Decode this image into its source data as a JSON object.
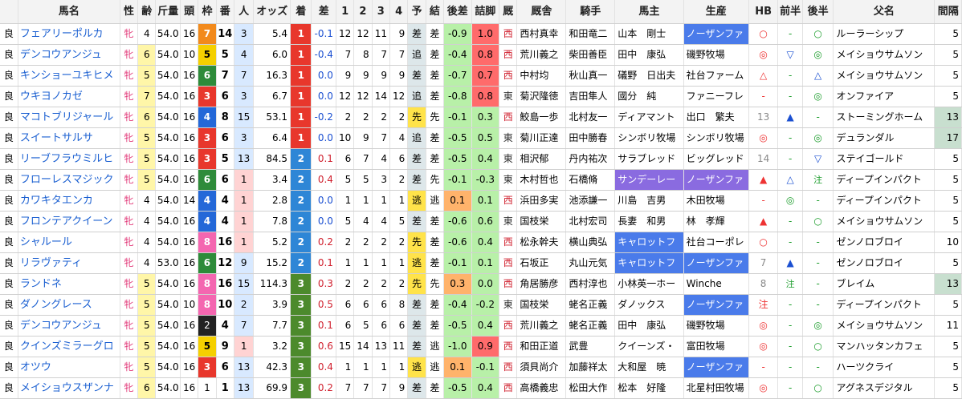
{
  "headers": [
    "",
    "馬名",
    "性",
    "齢",
    "斤量",
    "頭",
    "枠",
    "番",
    "人",
    "オッズ",
    "着",
    "差",
    "1",
    "2",
    "3",
    "4",
    "予",
    "結",
    "後差",
    "詰脚",
    "厩",
    "厩舎",
    "騎手",
    "馬主",
    "生産",
    "HB",
    "前半",
    "後半",
    "父名",
    "間隔"
  ],
  "rows": [
    [
      "良",
      "フェアリーポルカ",
      "牝",
      "4",
      "54.0",
      "16",
      "7",
      "14",
      "3",
      "5.4",
      "1",
      "-0.1",
      "12",
      "12",
      "11",
      "9",
      "差",
      "差",
      "-0.9",
      "1.0",
      "西",
      "西村真幸",
      "和田竜二",
      "山本　剛士",
      "ノーザンファ",
      "○",
      "-",
      "○",
      "ルーラーシップ",
      "5"
    ],
    [
      "良",
      "デンコウアンジュ",
      "牝",
      "6",
      "54.0",
      "10",
      "5",
      "5",
      "4",
      "6.0",
      "1",
      "-0.4",
      "7",
      "8",
      "7",
      "7",
      "追",
      "差",
      "-0.4",
      "0.8",
      "西",
      "荒川義之",
      "柴田善臣",
      "田中　康弘",
      "磯野牧場",
      "◎",
      "▽",
      "◎",
      "メイショウサムソン",
      "5"
    ],
    [
      "良",
      "キンショーユキヒメ",
      "牝",
      "5",
      "54.0",
      "16",
      "6",
      "7",
      "7",
      "16.3",
      "1",
      "0.0",
      "9",
      "9",
      "9",
      "9",
      "差",
      "差",
      "-0.7",
      "0.7",
      "西",
      "中村均",
      "秋山真一",
      "礒野　日出夫",
      "社台ファーム",
      "△",
      "-",
      "△",
      "メイショウサムソン",
      "5"
    ],
    [
      "良",
      "ウキヨノカゼ",
      "牝",
      "7",
      "54.0",
      "16",
      "3",
      "6",
      "3",
      "6.7",
      "1",
      "0.0",
      "12",
      "12",
      "14",
      "12",
      "追",
      "差",
      "-0.8",
      "0.8",
      "東",
      "菊沢隆徳",
      "吉田隼人",
      "國分　純",
      "ファニーフレ",
      "-",
      "-",
      "◎",
      "オンファイア",
      "5"
    ],
    [
      "良",
      "マコトブリジャール",
      "牝",
      "6",
      "54.0",
      "16",
      "4",
      "8",
      "15",
      "53.1",
      "1",
      "-0.2",
      "2",
      "2",
      "2",
      "2",
      "先",
      "先",
      "-0.1",
      "0.3",
      "西",
      "鮫島一歩",
      "北村友一",
      "ディアマント",
      "出口　繁夫",
      "13",
      "▲",
      "-",
      "ストーミングホーム",
      "13"
    ],
    [
      "良",
      "スイートサルサ",
      "牝",
      "5",
      "54.0",
      "16",
      "3",
      "6",
      "3",
      "6.4",
      "1",
      "0.0",
      "10",
      "9",
      "7",
      "4",
      "追",
      "差",
      "-0.5",
      "0.5",
      "東",
      "菊川正達",
      "田中勝春",
      "シンボリ牧場",
      "シンボリ牧場",
      "◎",
      "-",
      "◎",
      "デュランダル",
      "17"
    ],
    [
      "良",
      "リーブフラウミルヒ",
      "牝",
      "5",
      "54.0",
      "16",
      "3",
      "5",
      "13",
      "84.5",
      "2",
      "0.1",
      "6",
      "7",
      "4",
      "6",
      "差",
      "差",
      "-0.5",
      "0.4",
      "東",
      "相沢郁",
      "丹内祐次",
      "サラブレッド",
      "ビッグレッド",
      "14",
      "-",
      "▽",
      "ステイゴールド",
      "5"
    ],
    [
      "良",
      "フローレスマジック",
      "牝",
      "5",
      "54.0",
      "16",
      "6",
      "6",
      "1",
      "3.4",
      "2",
      "0.4",
      "5",
      "5",
      "3",
      "2",
      "差",
      "先",
      "-0.1",
      "-0.3",
      "東",
      "木村哲也",
      "石橋脩",
      "サンデーレー",
      "ノーザンファ",
      "▲",
      "△",
      "注",
      "ディープインパクト",
      "5"
    ],
    [
      "良",
      "カワキタエンカ",
      "牝",
      "4",
      "54.0",
      "14",
      "4",
      "4",
      "1",
      "2.8",
      "2",
      "0.0",
      "1",
      "1",
      "1",
      "1",
      "逃",
      "逃",
      "0.1",
      "0.1",
      "西",
      "浜田多実",
      "池添謙一",
      "川島　吉男",
      "木田牧場",
      "-",
      "◎",
      "-",
      "ディープインパクト",
      "5"
    ],
    [
      "良",
      "フロンテアクイーン",
      "牝",
      "4",
      "54.0",
      "16",
      "4",
      "4",
      "1",
      "7.8",
      "2",
      "0.0",
      "5",
      "4",
      "4",
      "5",
      "差",
      "差",
      "-0.6",
      "0.6",
      "東",
      "国枝栄",
      "北村宏司",
      "長妻　和男",
      "林　孝輝",
      "▲",
      "-",
      "○",
      "メイショウサムソン",
      "5"
    ],
    [
      "良",
      "シャルール",
      "牝",
      "4",
      "54.0",
      "16",
      "8",
      "16",
      "1",
      "5.2",
      "2",
      "0.2",
      "2",
      "2",
      "2",
      "2",
      "先",
      "差",
      "-0.6",
      "0.4",
      "西",
      "松永幹夫",
      "横山典弘",
      "キャロットフ",
      "社台コーポレ",
      "○",
      "-",
      "-",
      "ゼンノロブロイ",
      "10"
    ],
    [
      "良",
      "リラヴァティ",
      "牝",
      "4",
      "53.0",
      "16",
      "6",
      "12",
      "9",
      "15.2",
      "2",
      "0.1",
      "1",
      "1",
      "1",
      "1",
      "逃",
      "差",
      "-0.1",
      "0.1",
      "西",
      "石坂正",
      "丸山元気",
      "キャロットフ",
      "ノーザンファ",
      "7",
      "▲",
      "-",
      "ゼンノロブロイ",
      "5"
    ],
    [
      "良",
      "ランドネ",
      "牝",
      "5",
      "54.0",
      "16",
      "8",
      "16",
      "15",
      "114.3",
      "3",
      "0.3",
      "2",
      "2",
      "2",
      "2",
      "先",
      "先",
      "0.3",
      "0.0",
      "西",
      "角居勝彦",
      "西村淳也",
      "小林英一ホー",
      "Winche",
      "8",
      "注",
      "-",
      "ブレイム",
      "13"
    ],
    [
      "良",
      "ダノングレース",
      "牝",
      "5",
      "54.0",
      "10",
      "8",
      "10",
      "2",
      "3.9",
      "3",
      "0.5",
      "6",
      "6",
      "6",
      "8",
      "差",
      "差",
      "-0.4",
      "-0.2",
      "東",
      "国枝栄",
      "蛯名正義",
      "ダノックス",
      "ノーザンファ",
      "注",
      "-",
      "-",
      "ディープインパクト",
      "5"
    ],
    [
      "良",
      "デンコウアンジュ",
      "牝",
      "5",
      "54.0",
      "16",
      "2",
      "4",
      "7",
      "7.7",
      "3",
      "0.1",
      "6",
      "5",
      "6",
      "6",
      "差",
      "差",
      "-0.5",
      "0.4",
      "西",
      "荒川義之",
      "蛯名正義",
      "田中　康弘",
      "磯野牧場",
      "◎",
      "-",
      "◎",
      "メイショウサムソン",
      "11"
    ],
    [
      "良",
      "クインズミラーグロ",
      "牝",
      "5",
      "54.0",
      "16",
      "5",
      "9",
      "1",
      "3.2",
      "3",
      "0.6",
      "15",
      "14",
      "13",
      "11",
      "差",
      "逃",
      "-1.0",
      "0.9",
      "西",
      "和田正道",
      "武豊",
      "クイーンズ・",
      "富田牧場",
      "◎",
      "-",
      "○",
      "マンハッタンカフェ",
      "5"
    ],
    [
      "良",
      "オツウ",
      "牝",
      "5",
      "54.0",
      "16",
      "3",
      "6",
      "13",
      "42.3",
      "3",
      "0.4",
      "1",
      "1",
      "1",
      "1",
      "逃",
      "逃",
      "0.1",
      "-0.1",
      "西",
      "須貝尚介",
      "加藤祥太",
      "大和屋　暁",
      "ノーザンファ",
      "-",
      "-",
      "-",
      "ハーツクライ",
      "5"
    ],
    [
      "良",
      "メイショウスザンナ",
      "牝",
      "6",
      "54.0",
      "16",
      "1",
      "1",
      "13",
      "69.9",
      "3",
      "0.2",
      "7",
      "7",
      "7",
      "9",
      "差",
      "差",
      "-0.5",
      "0.4",
      "西",
      "高橋義忠",
      "松田大作",
      "松本　好隆",
      "北星村田牧場",
      "◎",
      "-",
      "○",
      "アグネスデジタル",
      "5"
    ]
  ]
}
